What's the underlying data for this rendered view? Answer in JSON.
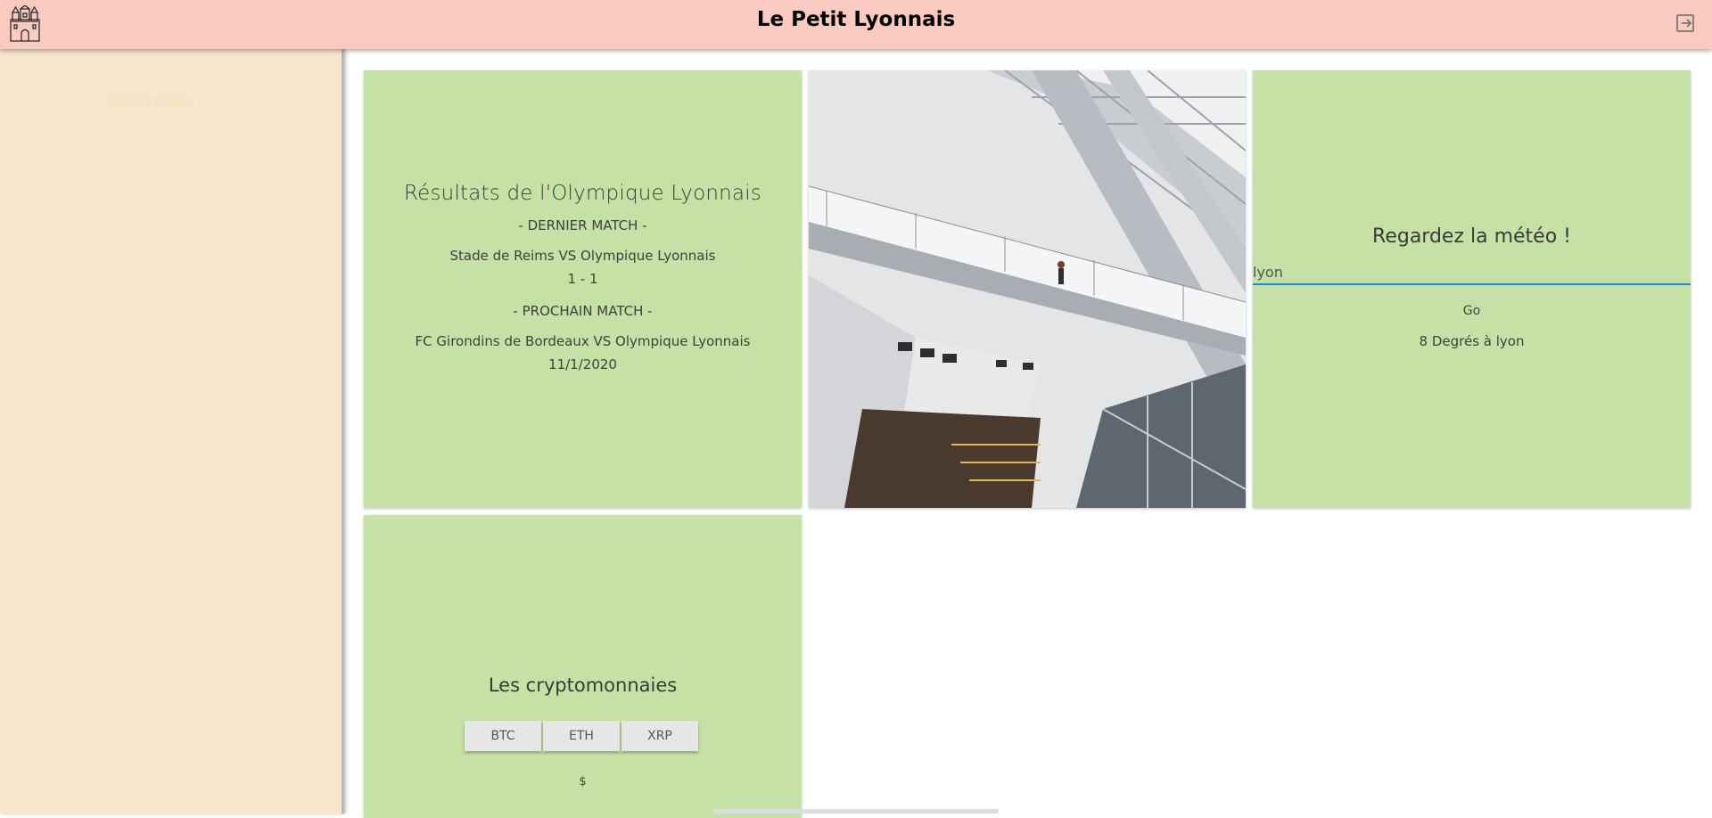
{
  "header": {
    "title": "Le Petit Lyonnais",
    "logo_icon": "castle-icon",
    "logout_icon": "logout-icon",
    "background": "#f9cac0"
  },
  "sidebar": {
    "background": "#f7e6cc",
    "link": "Déconnexion"
  },
  "ol_card": {
    "title": "Résultats de l'Olympique Lyonnais",
    "last_match_label": "- DERNIER MATCH -",
    "last_match_teams": "Stade de Reims VS Olympique Lyonnais",
    "last_match_score": "1 - 1",
    "next_match_label": "- PROCHAIN MATCH -",
    "next_match_teams": "FC Girondins de Bordeaux VS Olympique Lyonnais",
    "next_match_date": "11/1/2020",
    "background": "#c5e1a5"
  },
  "image_card": {
    "alt_icon": "museum-interior-photo"
  },
  "meteo_card": {
    "title": "Regardez la météo !",
    "input_value": "lyon",
    "go_label": "Go",
    "result": "8 Degrés à lyon"
  },
  "crypto_card": {
    "title": "Les cryptomonnaies",
    "buttons": [
      "BTC",
      "ETH",
      "XRP"
    ],
    "value": "$"
  }
}
